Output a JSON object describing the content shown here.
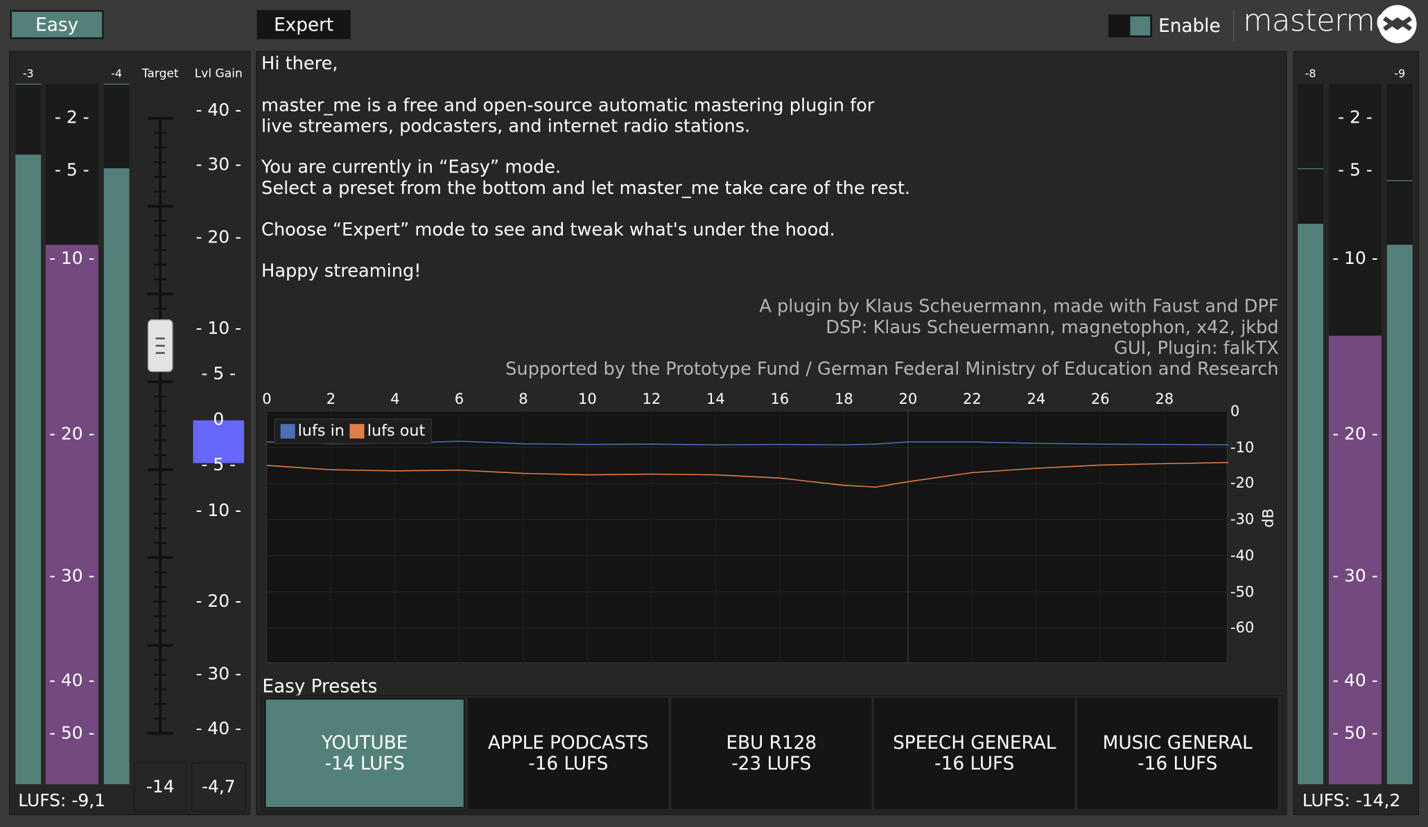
{
  "header": {
    "easy_label": "Easy",
    "expert_label": "Expert",
    "enable_label": "Enable",
    "logo_text": "masterme"
  },
  "left_panel": {
    "meter_in_peak": "-3",
    "meter_out_peak": "-4",
    "target_label": "Target",
    "lvl_gain_label": "Lvl Gain",
    "scale": [
      "- 2 -",
      "- 5 -",
      "- 10 -",
      "- 20 -",
      "- 30 -",
      "- 40 -",
      "- 50 -"
    ],
    "gain_scale": [
      "- 40 -",
      "- 30 -",
      "- 20 -",
      "- 10 -",
      "- 5 -",
      "0",
      "- 5 -",
      "- 10 -",
      "- 20 -",
      "- 30 -",
      "- 40 -"
    ],
    "target_value": "-14",
    "gain_value": "-4,7",
    "lufs_readout": "LUFS: -9,1",
    "meter_in_level": 0.9,
    "meter_lufs_level": 0.77,
    "meter_out_level": 0.88,
    "target_level": 0.63,
    "gain_level": 0.1
  },
  "right_panel": {
    "meter_in_peak": "-8",
    "meter_out_peak": "-9",
    "scale": [
      "- 2 -",
      "- 5 -",
      "- 10 -",
      "- 20 -",
      "- 30 -",
      "- 40 -",
      "- 50 -"
    ],
    "lufs_readout": "LUFS: -14,2",
    "meter_in_level": 0.8,
    "meter_lufs_level": 0.64,
    "meter_out_level": 0.77
  },
  "intro": {
    "greeting": "Hi there,",
    "line1": "master_me is a free and open-source automatic mastering plugin for",
    "line2": "live streamers, podcasters, and internet radio stations.",
    "line3": "You are currently in “Easy” mode.",
    "line4": "Select a preset from the bottom and let master_me take care of the rest.",
    "line5": "Choose “Expert” mode to see and tweak what's under the hood.",
    "line6": "Happy streaming!",
    "credit1": "A plugin by Klaus Scheuermann, made with Faust and DPF",
    "credit2": "DSP: Klaus Scheuermann, magnetophon, x42, jkbd",
    "credit3": "GUI, Plugin: falkTX",
    "credit4": "Supported by the Prototype Fund / German Federal Ministry of Education and Research"
  },
  "chart_data": {
    "type": "line",
    "xlabel": "",
    "ylabel": "dB",
    "x_ticks": [
      "0",
      "2",
      "4",
      "6",
      "8",
      "10",
      "12",
      "14",
      "16",
      "18",
      "20",
      "22",
      "24",
      "26",
      "28"
    ],
    "y_ticks": [
      "0",
      "-10",
      "-20",
      "-30",
      "-40",
      "-50",
      "-60"
    ],
    "xlim": [
      0,
      30
    ],
    "ylim": [
      -70,
      0
    ],
    "legend_position": "top-left",
    "x": [
      0,
      2,
      4,
      6,
      8,
      10,
      12,
      14,
      16,
      18,
      19,
      20,
      22,
      24,
      26,
      28,
      30
    ],
    "series": [
      {
        "name": "lufs in",
        "color": "#4a6fb5",
        "values": [
          -8.5,
          -9,
          -8.9,
          -8.3,
          -9,
          -9.2,
          -9.1,
          -9.3,
          -9.2,
          -9.3,
          -9.1,
          -8.5,
          -8.5,
          -8.9,
          -9.1,
          -9.2,
          -9.3
        ]
      },
      {
        "name": "lufs out",
        "color": "#e07f45",
        "values": [
          -15,
          -16.2,
          -16.5,
          -16.3,
          -17.2,
          -17.6,
          -17.4,
          -17.6,
          -18.5,
          -20.5,
          -21,
          -19.5,
          -17,
          -15.8,
          -14.9,
          -14.5,
          -14.2
        ]
      }
    ]
  },
  "presets": {
    "title": "Easy Presets",
    "items": [
      {
        "name": "YOUTUBE",
        "lufs": "-14 LUFS"
      },
      {
        "name": "APPLE PODCASTS",
        "lufs": "-16 LUFS"
      },
      {
        "name": "EBU R128",
        "lufs": "-23 LUFS"
      },
      {
        "name": "SPEECH GENERAL",
        "lufs": "-16 LUFS"
      },
      {
        "name": "MUSIC GENERAL",
        "lufs": "-16 LUFS"
      }
    ]
  },
  "colors": {
    "accent": "#54807a",
    "lufs_meter": "#74497f",
    "gain_bar": "#6767fb",
    "background": "#3a3a3a"
  }
}
